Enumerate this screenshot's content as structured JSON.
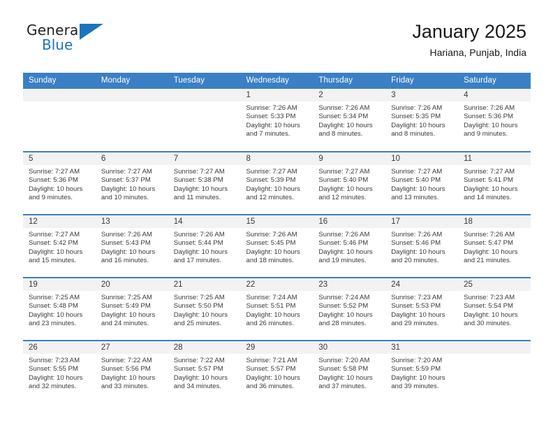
{
  "brand": {
    "name_part1": "General",
    "name_part2": "Blue",
    "logo_icon": "triangle-logo-icon"
  },
  "header": {
    "title": "January 2025",
    "location": "Hariana, Punjab, India"
  },
  "calendar": {
    "weekday_headers": [
      "Sunday",
      "Monday",
      "Tuesday",
      "Wednesday",
      "Thursday",
      "Friday",
      "Saturday"
    ],
    "accent_color": "#3b7fc4",
    "daynum_strip_color": "#f2f2f2",
    "weeks": [
      [
        {
          "day": "",
          "lines": []
        },
        {
          "day": "",
          "lines": []
        },
        {
          "day": "",
          "lines": []
        },
        {
          "day": "1",
          "lines": [
            "Sunrise: 7:26 AM",
            "Sunset: 5:33 PM",
            "Daylight: 10 hours",
            "and 7 minutes."
          ]
        },
        {
          "day": "2",
          "lines": [
            "Sunrise: 7:26 AM",
            "Sunset: 5:34 PM",
            "Daylight: 10 hours",
            "and 8 minutes."
          ]
        },
        {
          "day": "3",
          "lines": [
            "Sunrise: 7:26 AM",
            "Sunset: 5:35 PM",
            "Daylight: 10 hours",
            "and 8 minutes."
          ]
        },
        {
          "day": "4",
          "lines": [
            "Sunrise: 7:26 AM",
            "Sunset: 5:36 PM",
            "Daylight: 10 hours",
            "and 9 minutes."
          ]
        }
      ],
      [
        {
          "day": "5",
          "lines": [
            "Sunrise: 7:27 AM",
            "Sunset: 5:36 PM",
            "Daylight: 10 hours",
            "and 9 minutes."
          ]
        },
        {
          "day": "6",
          "lines": [
            "Sunrise: 7:27 AM",
            "Sunset: 5:37 PM",
            "Daylight: 10 hours",
            "and 10 minutes."
          ]
        },
        {
          "day": "7",
          "lines": [
            "Sunrise: 7:27 AM",
            "Sunset: 5:38 PM",
            "Daylight: 10 hours",
            "and 11 minutes."
          ]
        },
        {
          "day": "8",
          "lines": [
            "Sunrise: 7:27 AM",
            "Sunset: 5:39 PM",
            "Daylight: 10 hours",
            "and 12 minutes."
          ]
        },
        {
          "day": "9",
          "lines": [
            "Sunrise: 7:27 AM",
            "Sunset: 5:40 PM",
            "Daylight: 10 hours",
            "and 12 minutes."
          ]
        },
        {
          "day": "10",
          "lines": [
            "Sunrise: 7:27 AM",
            "Sunset: 5:40 PM",
            "Daylight: 10 hours",
            "and 13 minutes."
          ]
        },
        {
          "day": "11",
          "lines": [
            "Sunrise: 7:27 AM",
            "Sunset: 5:41 PM",
            "Daylight: 10 hours",
            "and 14 minutes."
          ]
        }
      ],
      [
        {
          "day": "12",
          "lines": [
            "Sunrise: 7:27 AM",
            "Sunset: 5:42 PM",
            "Daylight: 10 hours",
            "and 15 minutes."
          ]
        },
        {
          "day": "13",
          "lines": [
            "Sunrise: 7:26 AM",
            "Sunset: 5:43 PM",
            "Daylight: 10 hours",
            "and 16 minutes."
          ]
        },
        {
          "day": "14",
          "lines": [
            "Sunrise: 7:26 AM",
            "Sunset: 5:44 PM",
            "Daylight: 10 hours",
            "and 17 minutes."
          ]
        },
        {
          "day": "15",
          "lines": [
            "Sunrise: 7:26 AM",
            "Sunset: 5:45 PM",
            "Daylight: 10 hours",
            "and 18 minutes."
          ]
        },
        {
          "day": "16",
          "lines": [
            "Sunrise: 7:26 AM",
            "Sunset: 5:46 PM",
            "Daylight: 10 hours",
            "and 19 minutes."
          ]
        },
        {
          "day": "17",
          "lines": [
            "Sunrise: 7:26 AM",
            "Sunset: 5:46 PM",
            "Daylight: 10 hours",
            "and 20 minutes."
          ]
        },
        {
          "day": "18",
          "lines": [
            "Sunrise: 7:26 AM",
            "Sunset: 5:47 PM",
            "Daylight: 10 hours",
            "and 21 minutes."
          ]
        }
      ],
      [
        {
          "day": "19",
          "lines": [
            "Sunrise: 7:25 AM",
            "Sunset: 5:48 PM",
            "Daylight: 10 hours",
            "and 23 minutes."
          ]
        },
        {
          "day": "20",
          "lines": [
            "Sunrise: 7:25 AM",
            "Sunset: 5:49 PM",
            "Daylight: 10 hours",
            "and 24 minutes."
          ]
        },
        {
          "day": "21",
          "lines": [
            "Sunrise: 7:25 AM",
            "Sunset: 5:50 PM",
            "Daylight: 10 hours",
            "and 25 minutes."
          ]
        },
        {
          "day": "22",
          "lines": [
            "Sunrise: 7:24 AM",
            "Sunset: 5:51 PM",
            "Daylight: 10 hours",
            "and 26 minutes."
          ]
        },
        {
          "day": "23",
          "lines": [
            "Sunrise: 7:24 AM",
            "Sunset: 5:52 PM",
            "Daylight: 10 hours",
            "and 28 minutes."
          ]
        },
        {
          "day": "24",
          "lines": [
            "Sunrise: 7:23 AM",
            "Sunset: 5:53 PM",
            "Daylight: 10 hours",
            "and 29 minutes."
          ]
        },
        {
          "day": "25",
          "lines": [
            "Sunrise: 7:23 AM",
            "Sunset: 5:54 PM",
            "Daylight: 10 hours",
            "and 30 minutes."
          ]
        }
      ],
      [
        {
          "day": "26",
          "lines": [
            "Sunrise: 7:23 AM",
            "Sunset: 5:55 PM",
            "Daylight: 10 hours",
            "and 32 minutes."
          ]
        },
        {
          "day": "27",
          "lines": [
            "Sunrise: 7:22 AM",
            "Sunset: 5:56 PM",
            "Daylight: 10 hours",
            "and 33 minutes."
          ]
        },
        {
          "day": "28",
          "lines": [
            "Sunrise: 7:22 AM",
            "Sunset: 5:57 PM",
            "Daylight: 10 hours",
            "and 34 minutes."
          ]
        },
        {
          "day": "29",
          "lines": [
            "Sunrise: 7:21 AM",
            "Sunset: 5:57 PM",
            "Daylight: 10 hours",
            "and 36 minutes."
          ]
        },
        {
          "day": "30",
          "lines": [
            "Sunrise: 7:20 AM",
            "Sunset: 5:58 PM",
            "Daylight: 10 hours",
            "and 37 minutes."
          ]
        },
        {
          "day": "31",
          "lines": [
            "Sunrise: 7:20 AM",
            "Sunset: 5:59 PM",
            "Daylight: 10 hours",
            "and 39 minutes."
          ]
        },
        {
          "day": "",
          "lines": []
        }
      ]
    ]
  }
}
